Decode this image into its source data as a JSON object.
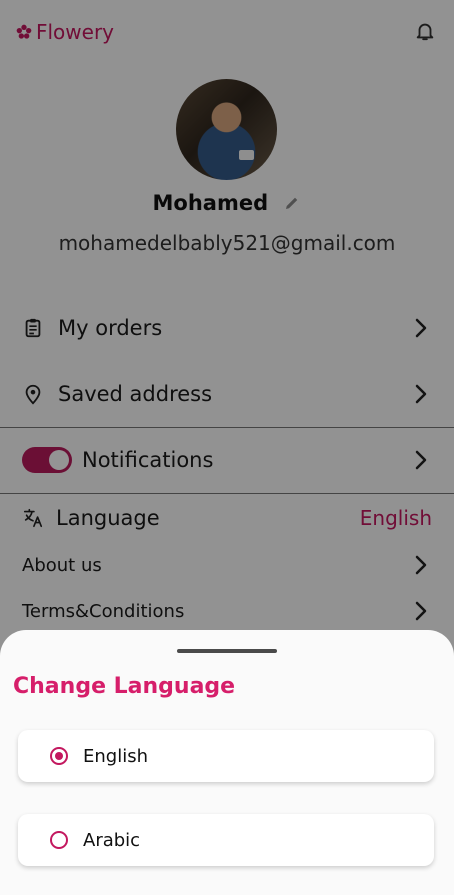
{
  "brand": {
    "name": "Flowery"
  },
  "profile": {
    "name": "Mohamed",
    "email": "mohamedelbably521@gmail.com"
  },
  "menu": {
    "orders": "My orders",
    "saved_address": "Saved address",
    "notifications": "Notifications",
    "notifications_enabled": true,
    "language_label": "Language",
    "language_value": "English",
    "about": "About us",
    "terms": "Terms&Conditions"
  },
  "sheet": {
    "title": "Change Language",
    "options": [
      {
        "label": "English",
        "selected": true
      },
      {
        "label": "Arabic",
        "selected": false
      }
    ]
  },
  "colors": {
    "accent": "#c3185f",
    "title": "#d61e6a"
  },
  "icons": [
    "flower-icon",
    "bell-icon",
    "pencil-icon",
    "orders-icon",
    "location-pin-icon",
    "translate-icon",
    "chevron-right-icon"
  ]
}
